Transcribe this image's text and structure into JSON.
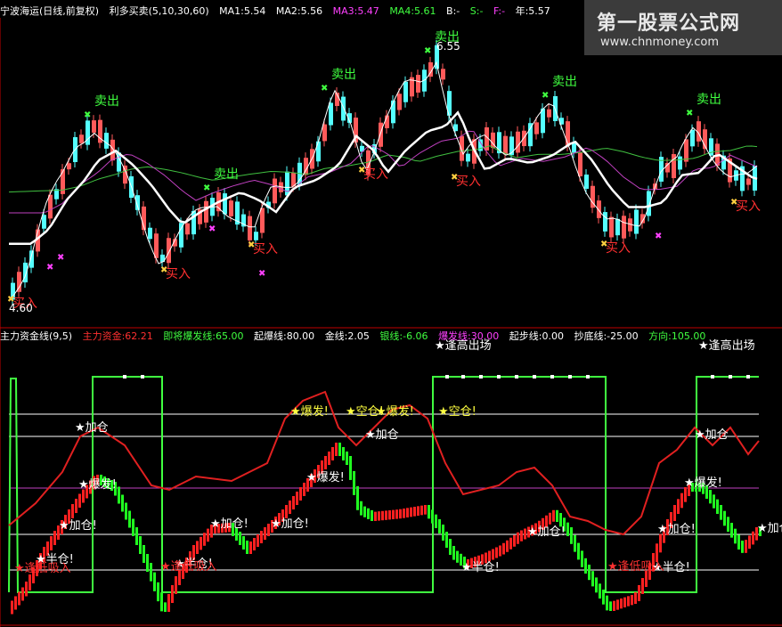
{
  "watermark": {
    "title": "第一股票公式网",
    "url": "www.chnmoney.com"
  },
  "top_header": {
    "title": "宁波海运(日线,前复权)",
    "indicator": "利多买卖(5,10,30,60)",
    "ma1": "MA1:5.54",
    "ma2": "MA2:5.56",
    "ma3": "MA3:5.47",
    "ma4": "MA4:5.61",
    "b": "B:-",
    "s": "S:-",
    "f": "F:-",
    "year": "年:5.57"
  },
  "bottom_header": {
    "title": "主力资金线(9,5)",
    "main_fund": "主力资金:62.21",
    "near_burst": "即将爆发线:65.00",
    "burst_start": "起爆线:80.00",
    "gold": "金线:2.05",
    "silver": "银线:-6.06",
    "burst": "爆发线:30.00",
    "start": "起步线:0.00",
    "bottom": "抄底线:-25.00",
    "direction": "方向:105.00"
  },
  "price_labels": {
    "high": "6.55",
    "low": "4.60"
  },
  "signal_labels": {
    "sell": "卖出",
    "buy": "买入"
  },
  "osc_labels": [
    "加仓",
    "爆发!",
    "空仓!",
    "半仓!",
    "加仓!",
    "逢低吸入",
    "逢高出场"
  ],
  "colors": {
    "bg": "#000000",
    "up": "#ff5a5a",
    "down": "#54ffff",
    "ma1": "#ffffff",
    "ma_white": "#ffffff",
    "ma_magenta": "#c040c0",
    "ma_green": "#40c040",
    "sell": "#40ff40",
    "buy": "#ff3030",
    "star": "#ffffff",
    "star_yellow": "#ffff40",
    "osc_red": "#ff2020",
    "osc_green": "#20ff20",
    "main_fund_line": "#e02020",
    "direction_line": "#40ff40",
    "level_line": "#ffffff",
    "mid_line": "#c040c0",
    "divider": "#c00000"
  }
}
